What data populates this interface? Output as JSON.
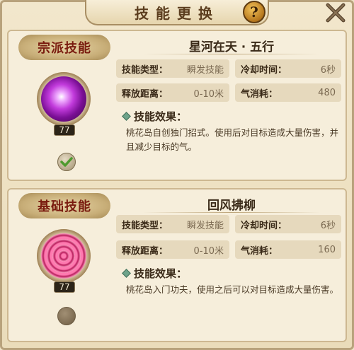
{
  "header": {
    "title": "技能更换",
    "help_label": "?",
    "close_icon": "close-icon"
  },
  "skills": [
    {
      "category": "宗派技能",
      "name": "星河在天 · 五行",
      "level": "77",
      "orb_color": "#c23bdc",
      "selected": true,
      "stats": {
        "type_label": "技能类型：",
        "type_value": "瞬发技能",
        "cooldown_label": "冷却时间：",
        "cooldown_value": "6秒",
        "range_label": "释放距离：",
        "range_value": "0-10米",
        "qi_label": "气消耗：",
        "qi_value": "480"
      },
      "effect_label": "技能效果：",
      "effect_text": "桃花岛自创独门招式。使用后对目标造成大量伤害，并且减少目标的气。"
    },
    {
      "category": "基础技能",
      "name": "回风拂柳",
      "level": "77",
      "orb_color": "#ff5a97",
      "selected": false,
      "stats": {
        "type_label": "技能类型：",
        "type_value": "瞬发技能",
        "cooldown_label": "冷却时间：",
        "cooldown_value": "6秒",
        "range_label": "释放距离：",
        "range_value": "0-10米",
        "qi_label": "气消耗：",
        "qi_value": "160"
      },
      "effect_label": "技能效果：",
      "effect_text": "桃花岛入门功夫，使用之后可以对目标造成大量伤害。"
    }
  ]
}
